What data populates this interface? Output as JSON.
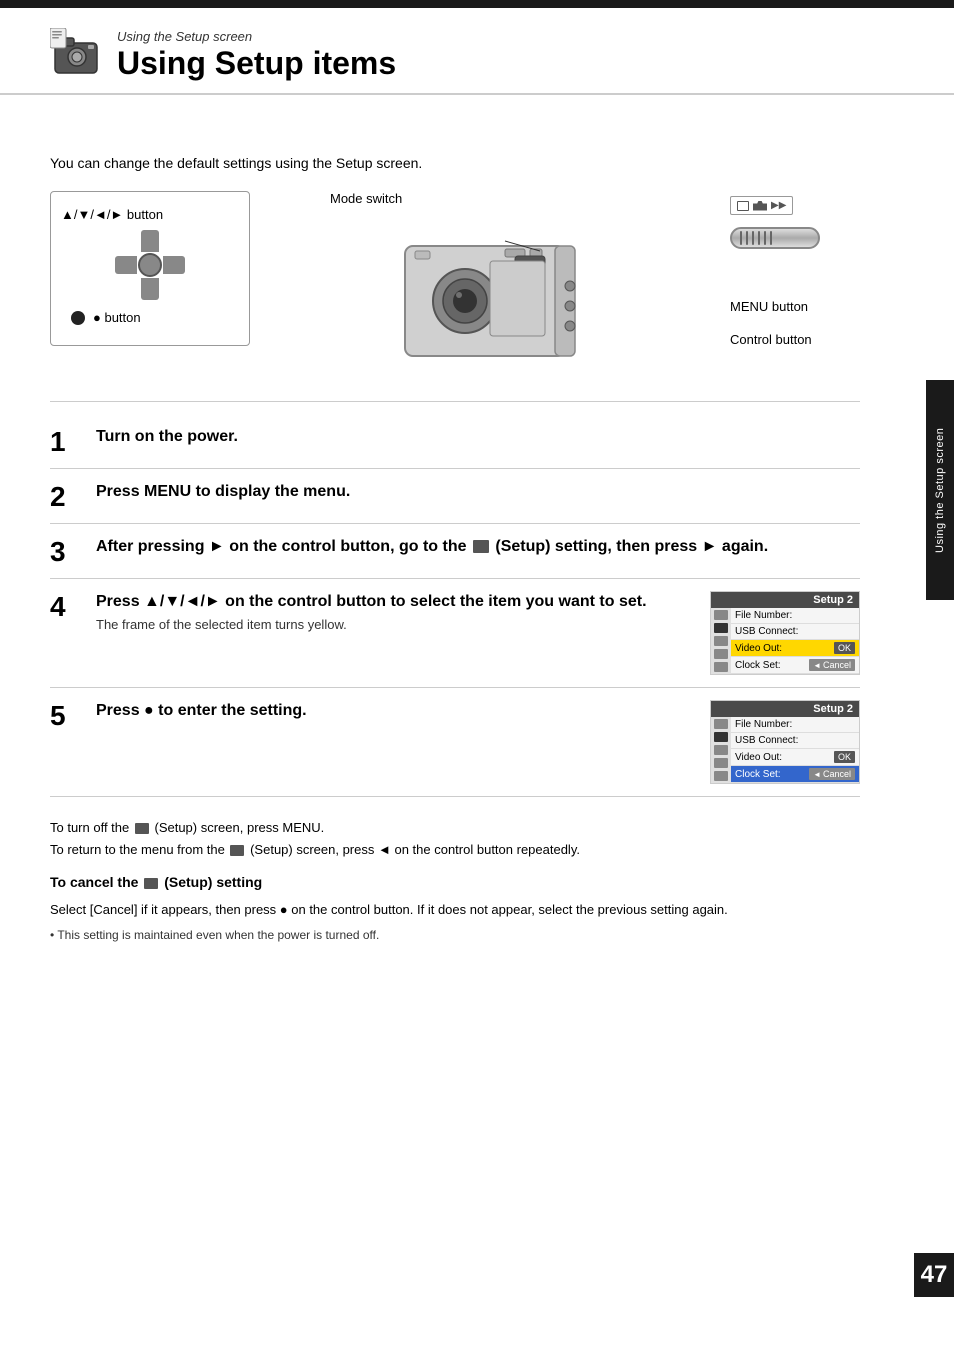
{
  "header": {
    "subtitle": "Using the Setup screen",
    "title": "Using Setup items"
  },
  "intro": "You can change the default settings using the Setup screen.",
  "diagram": {
    "dpad_label": "▲/▼/◄/► button",
    "bullet_label": "● button",
    "mode_switch_label": "Mode switch",
    "menu_button_label": "MENU button",
    "control_button_label": "Control button"
  },
  "steps": [
    {
      "number": "1",
      "title": "Turn on the power.",
      "desc": ""
    },
    {
      "number": "2",
      "title": "Press MENU to display the menu.",
      "desc": ""
    },
    {
      "number": "3",
      "title": "After pressing ► on the control button, go to the  (Setup) setting, then press ► again.",
      "desc": ""
    },
    {
      "number": "4",
      "title": "Press ▲/▼/◄/► on the control button to select the item you want to set.",
      "desc": "The frame of the selected item turns yellow.",
      "setup_screen": {
        "title": "Setup 2",
        "rows": [
          {
            "label": "File Number:",
            "value": "",
            "highlighted": false
          },
          {
            "label": "USB Connect:",
            "value": "",
            "highlighted": false
          },
          {
            "label": "Video Out:",
            "value": "OK",
            "highlighted": true
          },
          {
            "label": "Clock Set:",
            "value": "◄ Cancel",
            "highlighted": false
          }
        ]
      }
    },
    {
      "number": "5",
      "title": "Press ● to enter the setting.",
      "desc": "",
      "setup_screen": {
        "title": "Setup 2",
        "rows": [
          {
            "label": "File Number:",
            "value": "",
            "highlighted": false
          },
          {
            "label": "USB Connect:",
            "value": "",
            "highlighted": false
          },
          {
            "label": "Video Out:",
            "value": "OK",
            "highlighted": false
          },
          {
            "label": "Clock Set:",
            "value": "◄ Cancel",
            "highlighted": true
          }
        ]
      }
    }
  ],
  "footer": {
    "note1": "To turn off the  (Setup) screen, press MENU.",
    "note2": "To return to the menu from the  (Setup) screen, press ◄ on the control button repeatedly.",
    "cancel_heading": "To cancel the  (Setup) setting",
    "cancel_desc": "Select [Cancel] if it appears, then press ● on the control button. If it does not appear, select the previous setting again.",
    "bullet_note": "This setting is maintained even when the power is turned off."
  },
  "side_tab": "Using the Setup screen",
  "page_number": "47"
}
